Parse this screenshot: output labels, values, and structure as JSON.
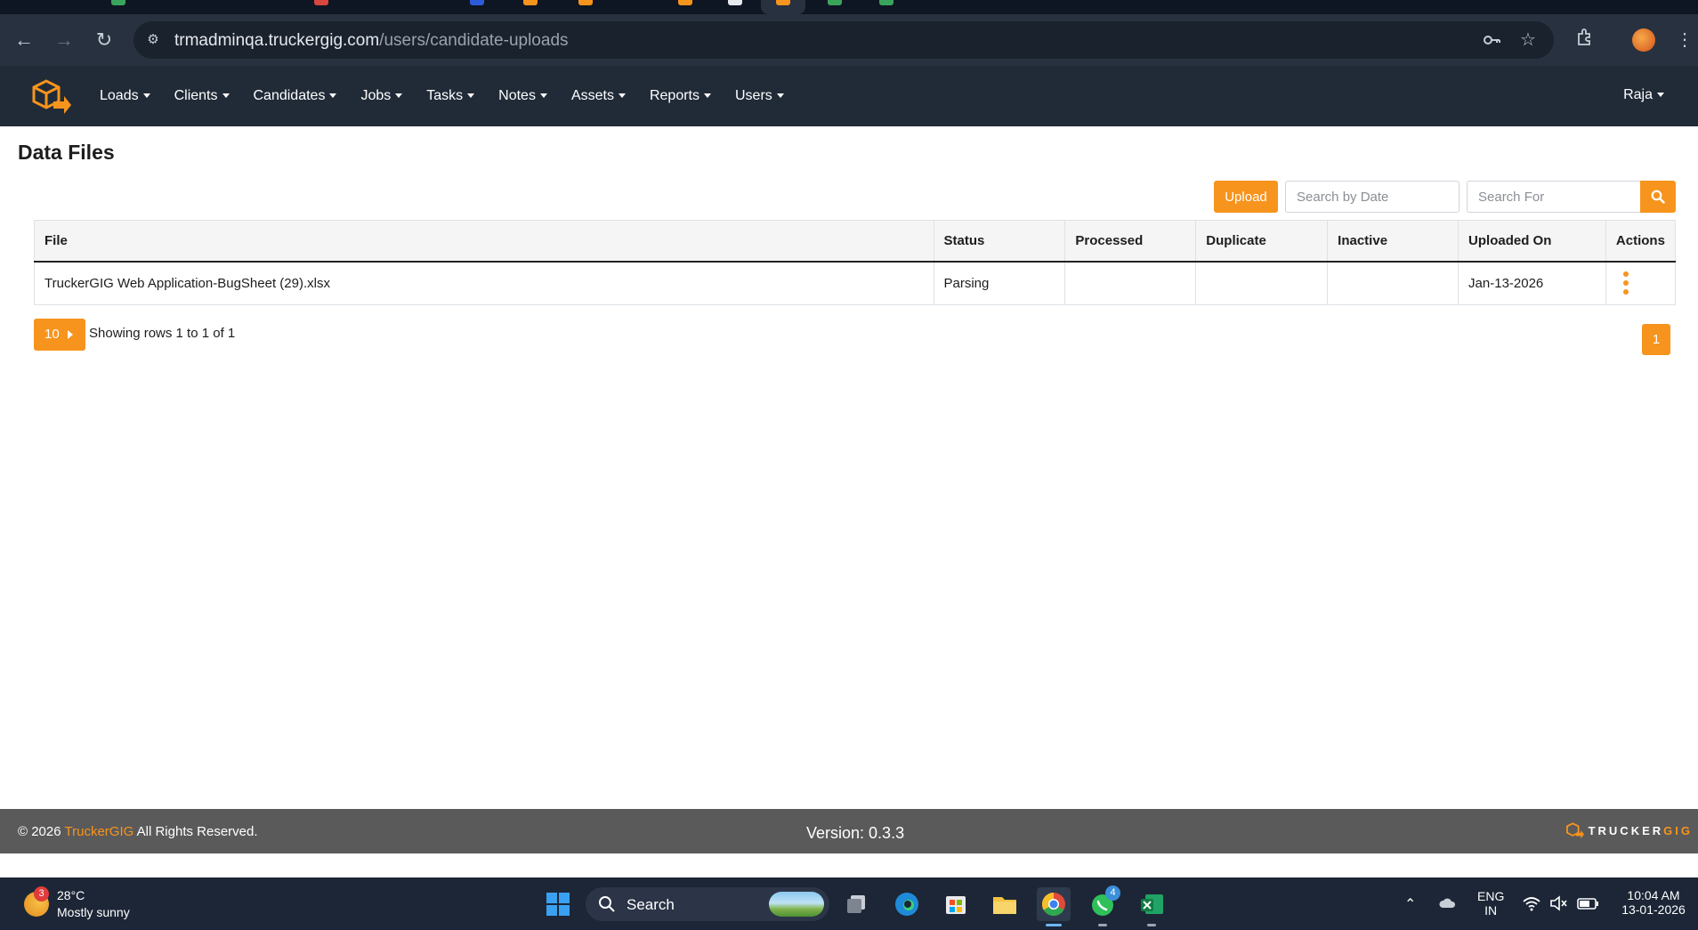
{
  "browser": {
    "url_host": "trmadminqa.truckergig.com",
    "url_path": "/users/candidate-uploads"
  },
  "nav": {
    "menu": [
      "Loads",
      "Clients",
      "Candidates",
      "Jobs",
      "Tasks",
      "Notes",
      "Assets",
      "Reports",
      "Users"
    ],
    "user": "Raja"
  },
  "page": {
    "title": "Data Files",
    "upload_label": "Upload",
    "date_placeholder": "Search by Date",
    "search_placeholder": "Search For"
  },
  "table": {
    "headers": [
      "File",
      "Status",
      "Processed",
      "Duplicate",
      "Inactive",
      "Uploaded On",
      "Actions"
    ],
    "rows": [
      {
        "file": "TruckerGIG Web Application-BugSheet (29).xlsx",
        "status": "Parsing",
        "processed": "",
        "duplicate": "",
        "inactive": "",
        "uploaded_on": "Jan-13-2026"
      }
    ]
  },
  "pagination": {
    "page_size": "10",
    "info": "Showing rows 1 to 1 of 1",
    "current_page": "1"
  },
  "footer": {
    "copyright_prefix": "© 2026",
    "brand": "TruckerGIG",
    "rights": "All Rights Reserved.",
    "version": "Version: 0.3.3",
    "logo_word_a": "TRUCKER",
    "logo_word_b": "GIG"
  },
  "taskbar": {
    "weather_badge": "3",
    "temperature": "28°C",
    "weather": "Mostly sunny",
    "search_label": "Search",
    "whatsapp_badge": "4",
    "lang_top": "ENG",
    "lang_bottom": "IN",
    "time": "10:04 AM",
    "date": "13-01-2026"
  },
  "colors": {
    "accent": "#f7941d",
    "navbar": "#212b38",
    "footer": "#5a5a5a"
  }
}
